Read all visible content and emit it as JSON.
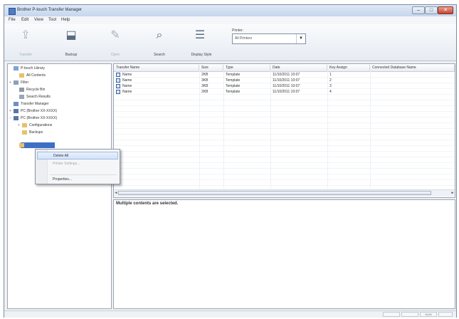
{
  "window": {
    "title": "Brother P-touch Transfer Manager",
    "min_glyph": "–",
    "max_glyph": "□",
    "close_glyph": "✕",
    "icon_name": "app-icon"
  },
  "menubar": [
    "File",
    "Edit",
    "View",
    "Tool",
    "Help"
  ],
  "toolbar": {
    "items": [
      {
        "label": "Transfer",
        "icon": "transfer-icon",
        "glyph": "⇪",
        "enabled": false
      },
      {
        "label": "Backup",
        "icon": "backup-icon",
        "glyph": "⬓",
        "enabled": true
      },
      {
        "label": "Open",
        "icon": "open-icon",
        "glyph": "✎",
        "enabled": false
      },
      {
        "label": "Search",
        "icon": "search-icon",
        "glyph": "⌕",
        "enabled": true
      },
      {
        "label": "Display Style",
        "icon": "display-style-icon",
        "glyph": "☰",
        "enabled": true
      }
    ],
    "printer_label": "Printer:",
    "printer_value": "All Printers",
    "printer_arrow": "▼"
  },
  "tree": [
    {
      "label": "P-touch Library",
      "expander": "",
      "icon": "library-icon",
      "color": "#7fa2d6"
    },
    {
      "label": "All Contents",
      "expander": "",
      "icon": "folder-icon",
      "color": "#e7c26a"
    },
    {
      "label": "Filter",
      "expander": "+",
      "icon": "filter-icon",
      "color": "#8aa0b8"
    },
    {
      "label": "Recycle Bin",
      "expander": "",
      "icon": "recycle-bin-icon",
      "color": "#8f9aa8"
    },
    {
      "label": "Search Results",
      "expander": "",
      "icon": "search-results-icon",
      "color": "#9aa6b5"
    },
    {
      "label": "Transfer Manager",
      "expander": "",
      "icon": "transfer-manager-icon",
      "color": "#6f8fc4"
    },
    {
      "label": "PC (Brother XX-XXXX)",
      "expander": "+",
      "icon": "printer-icon",
      "color": "#5a76a8"
    },
    {
      "label": "PC (Brother XX-XXXX)",
      "expander": "−",
      "icon": "printer-icon",
      "color": "#5a76a8"
    },
    {
      "label": "Configurations",
      "expander": "+",
      "icon": "folder-icon",
      "color": "#e7c26a"
    },
    {
      "label": "Backups",
      "expander": "",
      "icon": "folder-icon",
      "color": "#e7c26a"
    },
    {
      "label": "",
      "expander": "",
      "icon": "folder-icon",
      "color": "#e7c26a"
    }
  ],
  "list": {
    "columns": [
      "Transfer Name",
      "Size",
      "Type",
      "Date",
      "Key Assign",
      "Connected Database Name"
    ],
    "rows": [
      [
        "Name",
        "2KB",
        "Template",
        "11/10/2011 10:07",
        "1",
        ""
      ],
      [
        "Name",
        "3KB",
        "Template",
        "11/10/2011 10:07",
        "2",
        ""
      ],
      [
        "Name",
        "3KB",
        "Template",
        "11/10/2011 10:07",
        "3",
        ""
      ],
      [
        "Name",
        "2KB",
        "Template",
        "11/10/2011 10:07",
        "4",
        ""
      ]
    ]
  },
  "preview": {
    "text": "Multiple contents are selected."
  },
  "context_menu": {
    "items": [
      {
        "label": "Delete All",
        "state": "hover"
      },
      {
        "label": "Printer Settings...",
        "state": "disabled"
      },
      {
        "label": "Properties...",
        "state": "normal"
      }
    ]
  },
  "status": {
    "cells": [
      "",
      "",
      "NUM",
      ""
    ]
  }
}
